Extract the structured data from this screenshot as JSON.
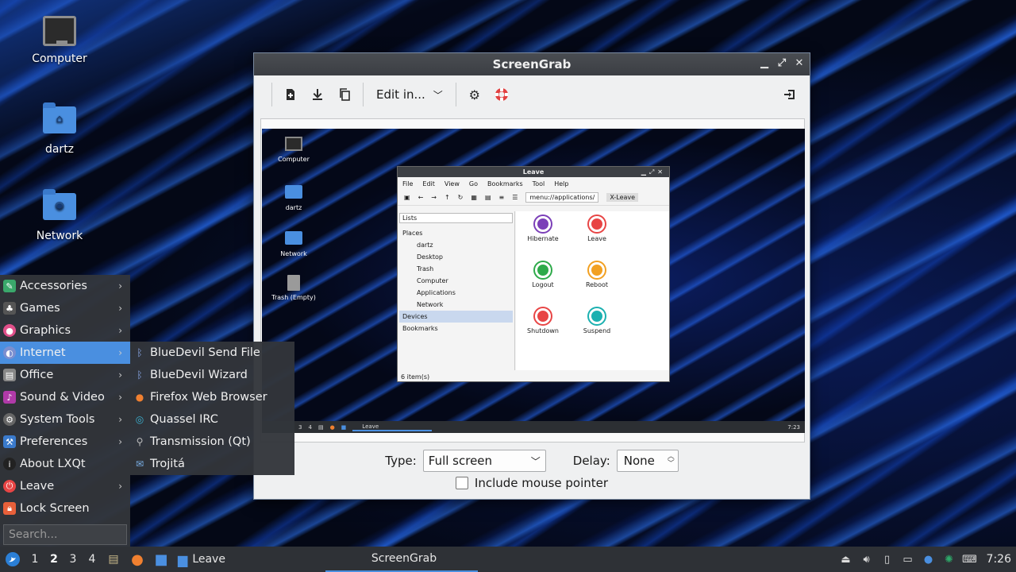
{
  "desktop": {
    "icons": [
      {
        "label": "Computer"
      },
      {
        "label": "dartz"
      },
      {
        "label": "Network"
      }
    ]
  },
  "screengrab": {
    "title": "ScreenGrab",
    "edit_in_label": "Edit in...",
    "type_label": "Type:",
    "type_value": "Full screen",
    "delay_label": "Delay:",
    "delay_value": "None",
    "include_pointer_label": "Include mouse pointer",
    "preview": {
      "desktop_icons": [
        "Computer",
        "dartz",
        "Network",
        "Trash (Empty)"
      ],
      "leave_window": {
        "title": "Leave",
        "menu": [
          "File",
          "Edit",
          "View",
          "Go",
          "Bookmarks",
          "Tool",
          "Help"
        ],
        "path": "menu://applications/",
        "tab": "X-Leave",
        "side_combo": "Lists",
        "side_header_places": "Places",
        "places": [
          "dartz",
          "Desktop",
          "Trash",
          "Computer",
          "Applications",
          "Network"
        ],
        "side_devices": "Devices",
        "side_bookmarks": "Bookmarks",
        "actions": [
          {
            "label": "Hibernate",
            "color": "#7b3fb8"
          },
          {
            "label": "Leave",
            "color": "#e84545"
          },
          {
            "label": "Logout",
            "color": "#2eaa4a"
          },
          {
            "label": "Reboot",
            "color": "#f2a021"
          },
          {
            "label": "Shutdown",
            "color": "#e84545"
          },
          {
            "label": "Suspend",
            "color": "#1bb0b0"
          }
        ],
        "status": "6 item(s)"
      },
      "panel_desktops": [
        "3",
        "4"
      ],
      "panel_task": "Leave",
      "panel_clock": "7:23"
    }
  },
  "menu": {
    "items": [
      {
        "label": "Accessories",
        "icon": "accessories-icon",
        "color": "#3aa86b",
        "submenu": true
      },
      {
        "label": "Games",
        "icon": "games-icon",
        "color": "#555",
        "submenu": true
      },
      {
        "label": "Graphics",
        "icon": "graphics-icon",
        "color": "#e0508a",
        "submenu": true
      },
      {
        "label": "Internet",
        "icon": "internet-icon",
        "color": "#7b8fd0",
        "submenu": true
      },
      {
        "label": "Office",
        "icon": "office-icon",
        "color": "#888",
        "submenu": true
      },
      {
        "label": "Sound & Video",
        "icon": "sound-video-icon",
        "color": "#b03aa8",
        "submenu": true
      },
      {
        "label": "System Tools",
        "icon": "system-tools-icon",
        "color": "#666",
        "submenu": true
      },
      {
        "label": "Preferences",
        "icon": "preferences-icon",
        "color": "#3a7acc",
        "submenu": true
      },
      {
        "label": "About LXQt",
        "icon": "about-icon",
        "color": "#222",
        "submenu": false
      },
      {
        "label": "Leave",
        "icon": "leave-icon",
        "color": "#e84545",
        "submenu": true
      },
      {
        "label": "Lock Screen",
        "icon": "lock-icon",
        "color": "#e8603a",
        "submenu": false
      }
    ],
    "search_placeholder": "Search..."
  },
  "internet_submenu": {
    "items": [
      {
        "label": "BlueDevil Send File",
        "icon": "bluetooth-icon"
      },
      {
        "label": "BlueDevil Wizard",
        "icon": "bluetooth-icon"
      },
      {
        "label": "Firefox Web Browser",
        "icon": "firefox-icon"
      },
      {
        "label": "Quassel IRC",
        "icon": "quassel-icon"
      },
      {
        "label": "Transmission (Qt)",
        "icon": "transmission-icon"
      },
      {
        "label": "Trojitá",
        "icon": "trojita-icon"
      }
    ]
  },
  "taskbar": {
    "desktops": [
      "1",
      "2",
      "3",
      "4"
    ],
    "current_desktop": "2",
    "tasks": [
      {
        "label": "Leave"
      },
      {
        "label": "ScreenGrab"
      }
    ],
    "clock": "7:26"
  },
  "colors": {
    "accent": "#4a8fe0",
    "panel": "#2e3136"
  }
}
